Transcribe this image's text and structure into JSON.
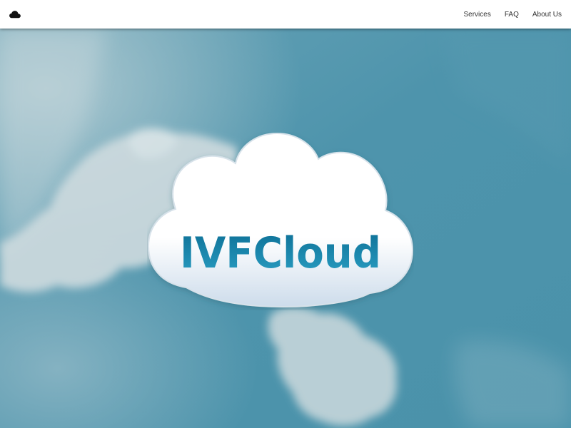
{
  "navbar": {
    "brand_icon": "cloud-icon",
    "links": [
      {
        "label": "Services"
      },
      {
        "label": "FAQ"
      },
      {
        "label": "About Us"
      }
    ]
  },
  "hero": {
    "logo_text": "IVFCloud",
    "background": "sky-with-clouds"
  },
  "colors": {
    "sky": "#4f95ad",
    "logo_text": "#1a7ea0",
    "navbar_bg": "#ffffff",
    "nav_text": "#333333"
  }
}
